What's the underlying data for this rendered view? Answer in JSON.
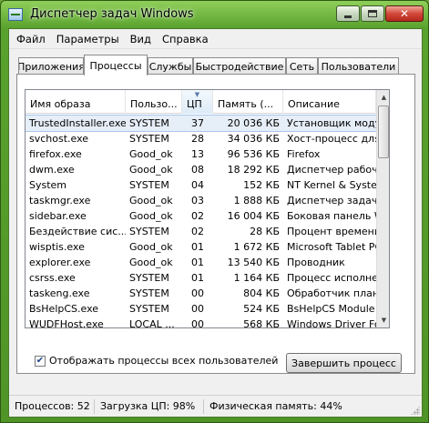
{
  "window": {
    "title": "Диспетчер задач Windows"
  },
  "menu": [
    "Файл",
    "Параметры",
    "Вид",
    "Справка"
  ],
  "tabs": [
    {
      "label": "Приложения",
      "active": false
    },
    {
      "label": "Процессы",
      "active": true
    },
    {
      "label": "Службы",
      "active": false
    },
    {
      "label": "Быстродействие",
      "active": false
    },
    {
      "label": "Сеть",
      "active": false
    },
    {
      "label": "Пользователи",
      "active": false
    }
  ],
  "table": {
    "headers": {
      "name": "Имя образа",
      "user": "Пользо...",
      "cpu": "ЦП",
      "memory": "Память (...",
      "description": "Описание"
    },
    "sorted_column": "cpu",
    "rows": [
      {
        "name": "TrustedInstaller.exe",
        "user": "SYSTEM",
        "cpu": "37",
        "memory": "20 036 КБ",
        "description": "Установщик модулей",
        "selected": true
      },
      {
        "name": "svchost.exe",
        "user": "SYSTEM",
        "cpu": "28",
        "memory": "34 036 КБ",
        "description": "Хост-процесс для слу"
      },
      {
        "name": "firefox.exe",
        "user": "Good_ok",
        "cpu": "13",
        "memory": "96 536 КБ",
        "description": "Firefox"
      },
      {
        "name": "dwm.exe",
        "user": "Good_ok",
        "cpu": "08",
        "memory": "18 292 КБ",
        "description": "Диспетчер рабочего"
      },
      {
        "name": "System",
        "user": "SYSTEM",
        "cpu": "04",
        "memory": "152 КБ",
        "description": "NT Kernel & System"
      },
      {
        "name": "taskmgr.exe",
        "user": "Good_ok",
        "cpu": "03",
        "memory": "1 888 КБ",
        "description": "Диспетчер задач Win"
      },
      {
        "name": "sidebar.exe",
        "user": "Good_ok",
        "cpu": "02",
        "memory": "16 004 КБ",
        "description": "Боковая панель Wind"
      },
      {
        "name": "Бездействие сис...",
        "user": "SYSTEM",
        "cpu": "02",
        "memory": "28 КБ",
        "description": "Процент времени бе"
      },
      {
        "name": "wisptis.exe",
        "user": "Good_ok",
        "cpu": "01",
        "memory": "1 672 КБ",
        "description": "Microsoft Tablet PC In"
      },
      {
        "name": "explorer.exe",
        "user": "Good_ok",
        "cpu": "01",
        "memory": "13 540 КБ",
        "description": "Проводник"
      },
      {
        "name": "csrss.exe",
        "user": "SYSTEM",
        "cpu": "01",
        "memory": "1 164 КБ",
        "description": "Процесс исполнения"
      },
      {
        "name": "taskeng.exe",
        "user": "SYSTEM",
        "cpu": "00",
        "memory": "804 КБ",
        "description": "Обработчик планиро"
      },
      {
        "name": "BsHelpCS.exe",
        "user": "SYSTEM",
        "cpu": "00",
        "memory": "524 КБ",
        "description": "BsHelpCS Module"
      },
      {
        "name": "WUDFHost.exe",
        "user": "LOCAL ...",
        "cpu": "00",
        "memory": "568 КБ",
        "description": "Windows Driver Found"
      }
    ]
  },
  "show_all_users": {
    "label": "Отображать процессы всех пользователей",
    "checked": true
  },
  "end_process_button": "Завершить процесс",
  "status": {
    "processes": "Процессов: 52",
    "cpu": "Загрузка ЦП: 98%",
    "memory": "Физическая память: 44%"
  }
}
